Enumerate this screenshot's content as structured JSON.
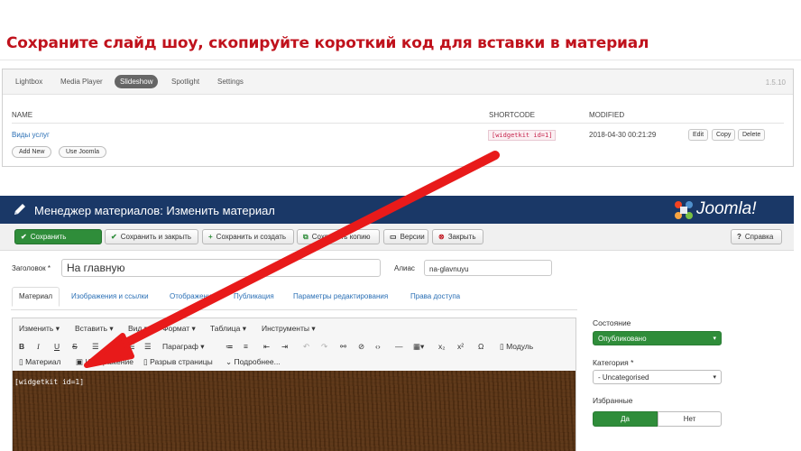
{
  "headline": "Сохраните слайд шоу, скопируйте короткий код для вставки в материал",
  "widgetkit": {
    "tabs": [
      "Lightbox",
      "Media Player",
      "Slideshow",
      "Spotlight",
      "Settings"
    ],
    "active_tab": "Slideshow",
    "version": "1.5.10",
    "columns": {
      "name": "NAME",
      "shortcode": "SHORTCODE",
      "modified": "MODIFIED"
    },
    "row": {
      "name": "Виды услуг",
      "shortcode": "[widgetkit id=1]",
      "modified": "2018-04-30 00:21:29",
      "actions": [
        "Edit",
        "Copy",
        "Delete"
      ]
    },
    "bottom_buttons": [
      "Add New",
      "Use Joomla"
    ]
  },
  "joomla": {
    "title": "Менеджер материалов: Изменить материал",
    "logo_text": "Joomla!",
    "toolbar": [
      {
        "label": "Сохранить",
        "icon": "check-icon"
      },
      {
        "label": "Сохранить и закрыть",
        "icon": "check-icon"
      },
      {
        "label": "Сохранить и создать",
        "icon": "plus-icon"
      },
      {
        "label": "Сохранить копию",
        "icon": "copy-icon"
      },
      {
        "label": "Версии",
        "icon": "versions-icon"
      },
      {
        "label": "Закрыть",
        "icon": "close-icon"
      },
      {
        "label": "Справка",
        "icon": "help-icon"
      }
    ],
    "title_label": "Заголовок *",
    "title_value": "На главную",
    "alias_label": "Алиас",
    "alias_value": "na-glavnuyu",
    "tabs": [
      "Материал",
      "Изображения и ссылки",
      "Отображение",
      "Публикация",
      "Параметры редактирования",
      "Права доступа"
    ],
    "editor": {
      "menus": [
        "Изменить ▾",
        "Вставить ▾",
        "Вид ▾",
        "Формат ▾",
        "Таблица ▾",
        "Инструменты ▾"
      ],
      "format_select": "Параграф",
      "module_button": "Модуль",
      "row3_buttons": [
        "Материал",
        "Изображение",
        "Разрыв страницы",
        "Подробнее..."
      ],
      "content": "[widgetkit id=1]"
    },
    "sidebar": {
      "status_label": "Состояние",
      "status_value": "Опубликовано",
      "category_label": "Категория *",
      "category_value": "- Uncategorised",
      "featured_label": "Избранные",
      "yes": "Да",
      "no": "Нет"
    }
  }
}
